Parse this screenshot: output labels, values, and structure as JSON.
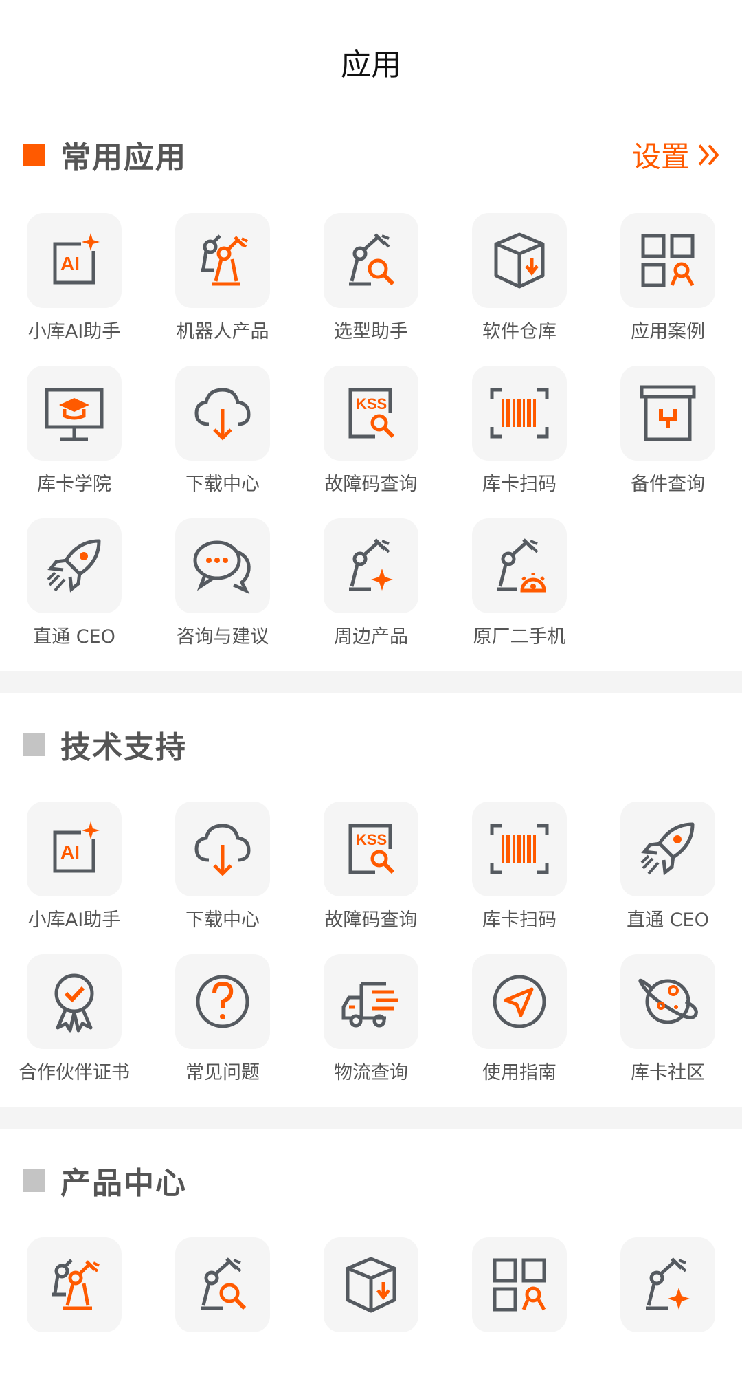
{
  "header": {
    "title": "应用"
  },
  "accent": "#ff5a00",
  "sections": [
    {
      "title": "常用应用",
      "square_color": "#ff5a00",
      "setting_label": "设置",
      "items": [
        {
          "label": "小库AI助手",
          "icon": "ai-assistant-icon"
        },
        {
          "label": "机器人产品",
          "icon": "robot-arm-icon"
        },
        {
          "label": "选型助手",
          "icon": "robot-search-icon"
        },
        {
          "label": "软件仓库",
          "icon": "package-download-icon"
        },
        {
          "label": "应用案例",
          "icon": "grid-award-icon"
        },
        {
          "label": "库卡学院",
          "icon": "academy-board-icon"
        },
        {
          "label": "下载中心",
          "icon": "cloud-download-icon"
        },
        {
          "label": "故障码查询",
          "icon": "kss-search-icon"
        },
        {
          "label": "库卡扫码",
          "icon": "barcode-scan-icon"
        },
        {
          "label": "备件查询",
          "icon": "spare-parts-box-icon"
        },
        {
          "label": "直通 CEO",
          "icon": "rocket-icon"
        },
        {
          "label": "咨询与建议",
          "icon": "chat-bubbles-icon"
        },
        {
          "label": "周边产品",
          "icon": "robot-star-icon"
        },
        {
          "label": "原厂二手机",
          "icon": "robot-gear-icon"
        }
      ]
    },
    {
      "title": "技术支持",
      "square_color": "#c4c4c4",
      "items": [
        {
          "label": "小库AI助手",
          "icon": "ai-assistant-icon"
        },
        {
          "label": "下载中心",
          "icon": "cloud-download-icon"
        },
        {
          "label": "故障码查询",
          "icon": "kss-search-icon"
        },
        {
          "label": "库卡扫码",
          "icon": "barcode-scan-icon"
        },
        {
          "label": "直通 CEO",
          "icon": "rocket-icon"
        },
        {
          "label": "合作伙伴证书",
          "icon": "certificate-badge-icon"
        },
        {
          "label": "常见问题",
          "icon": "question-circle-icon"
        },
        {
          "label": "物流查询",
          "icon": "delivery-truck-icon"
        },
        {
          "label": "使用指南",
          "icon": "compass-guide-icon"
        },
        {
          "label": "库卡社区",
          "icon": "planet-community-icon"
        }
      ]
    },
    {
      "title": "产品中心",
      "square_color": "#c4c4c4",
      "items": [
        {
          "label": "",
          "icon": "robot-arm-icon"
        },
        {
          "label": "",
          "icon": "robot-search-icon"
        },
        {
          "label": "",
          "icon": "package-download-icon"
        },
        {
          "label": "",
          "icon": "grid-award-icon"
        },
        {
          "label": "",
          "icon": "robot-star-icon"
        }
      ]
    }
  ]
}
